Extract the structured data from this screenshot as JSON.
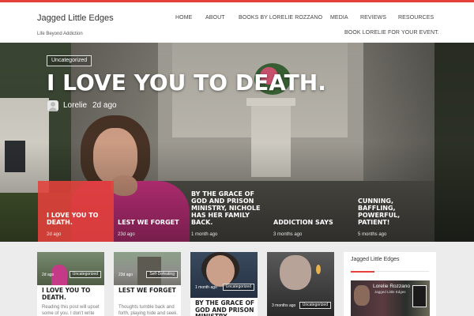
{
  "header": {
    "site_title": "Jagged Little Edges",
    "tagline": "Life Beyond Addiction",
    "accent_color": "#e5413b",
    "nav": {
      "home": "HOME",
      "about": "ABOUT",
      "books": "BOOKS BY LORELIE ROZZANO",
      "media": "MEDIA",
      "reviews": "REVIEWS",
      "resources": "RESOURCES",
      "book_event": "BOOK LORELIE FOR YOUR EVENT."
    }
  },
  "hero": {
    "category": "Uncategorized",
    "title": "I LOVE YOU TO DEATH.",
    "author": "Lorelie",
    "time": "2d ago",
    "avatar_icon": "user-avatar-icon"
  },
  "slider_tabs": [
    {
      "title": "I LOVE YOU TO DEATH.",
      "date": "2d ago",
      "active": true
    },
    {
      "title": "LEST WE FORGET",
      "date": "23d ago",
      "active": false
    },
    {
      "title": "BY THE GRACE OF GOD AND PRISON MINISTRY, NICHOLE HAS HER FAMILY BACK.",
      "date": "1 month ago",
      "active": false
    },
    {
      "title": "ADDICTION SAYS",
      "date": "3 months ago",
      "active": false
    },
    {
      "title": "CUNNING, BAFFLING, POWERFUL, PATIENT!",
      "date": "5 months ago",
      "active": false
    }
  ],
  "cards": [
    {
      "badge": "Uncategorized",
      "date": "2d ago",
      "title": "I LOVE YOU TO DEATH.",
      "excerpt": "Reading this post will upset some of you. I don't write"
    },
    {
      "badge": "Self-Defeating",
      "date": "23d ago",
      "title": "LEST WE FORGET",
      "excerpt": "Thoughts tumble back and forth, playing hide and seek. They're teasers,"
    },
    {
      "badge": "Uncategorized",
      "date": "1 month ago",
      "title": "BY THE GRACE OF GOD AND PRISON MINISTRY",
      "excerpt": ""
    },
    {
      "badge": "Uncategorized",
      "date": "3 months ago",
      "title": "",
      "excerpt": ""
    }
  ],
  "widget": {
    "title": "Jagged Little Edges",
    "cover_title": "Lorelie Rozzano",
    "cover_sub": "Jagged Little Edges"
  }
}
